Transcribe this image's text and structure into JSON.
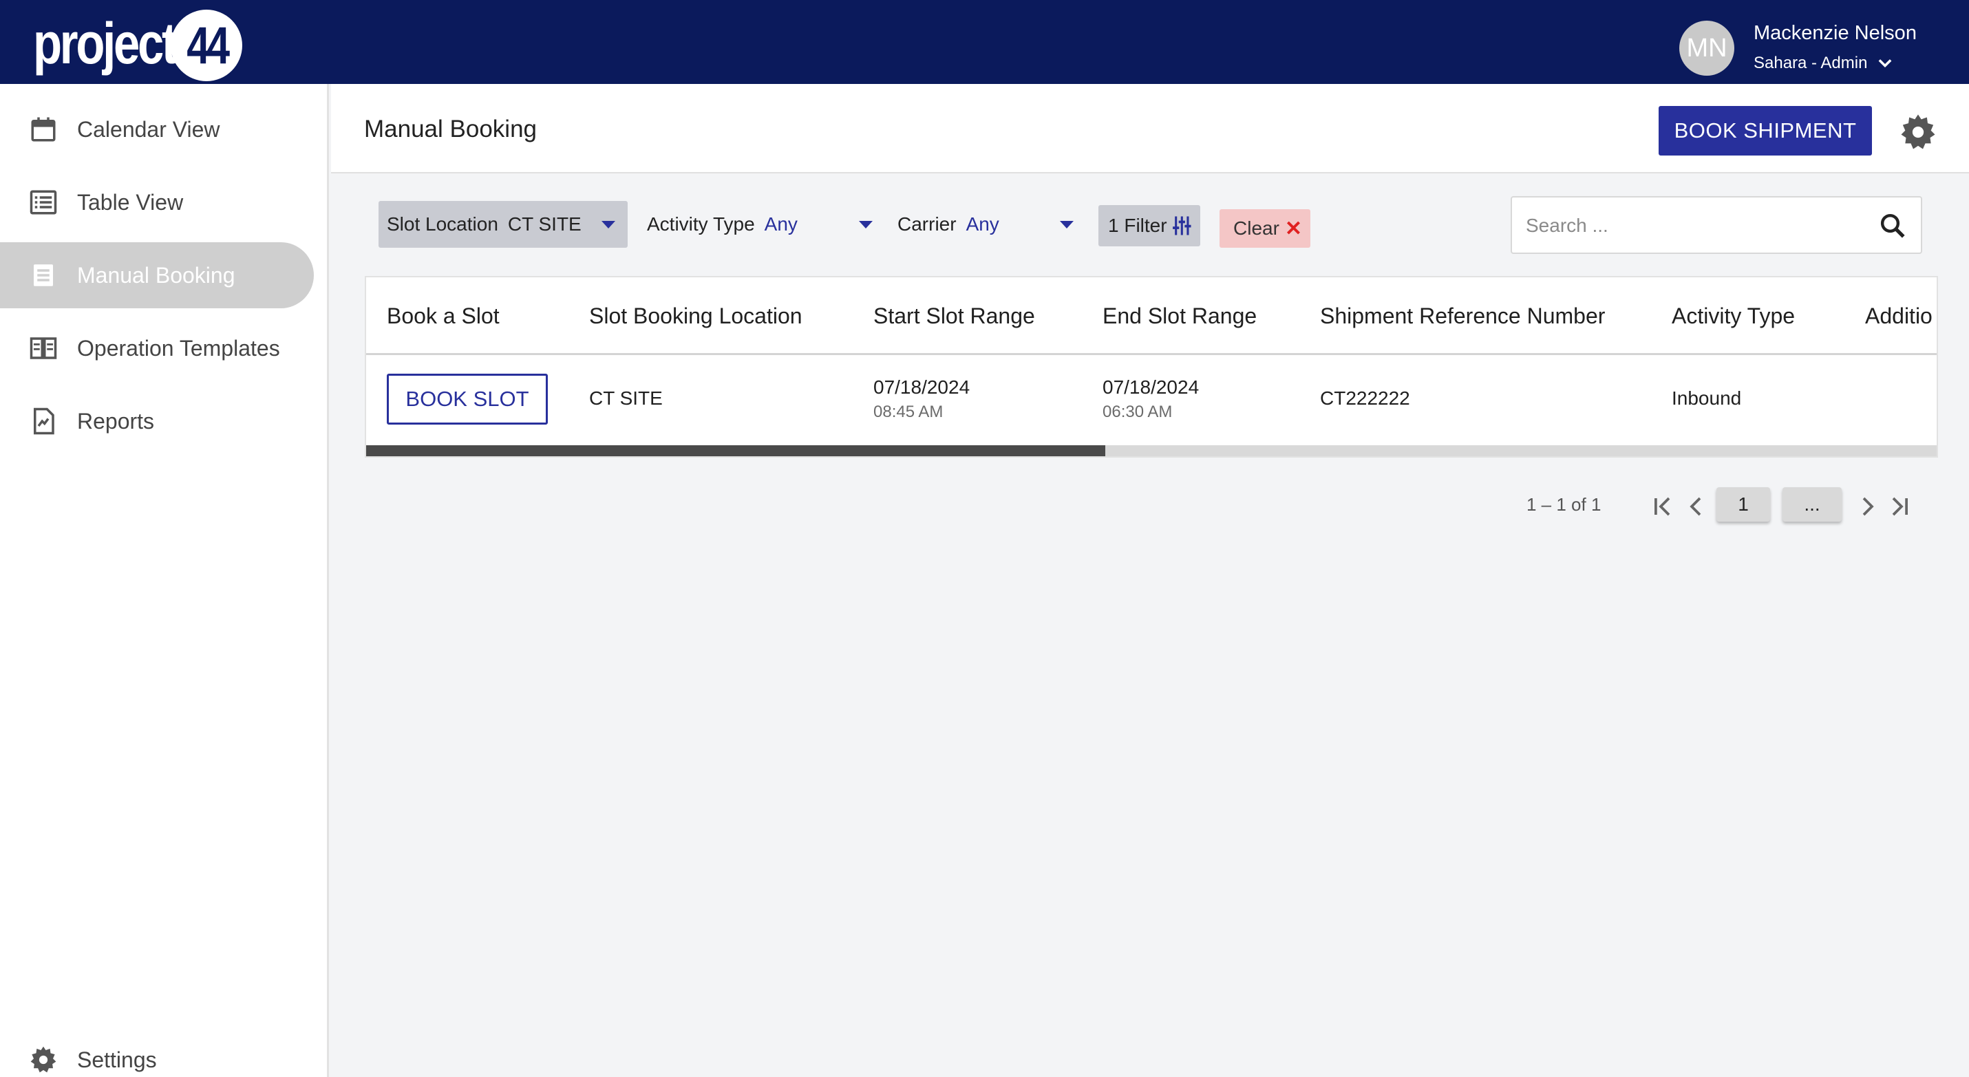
{
  "brand": {
    "logo_text": "project",
    "logo_number": "44"
  },
  "user": {
    "initials": "MN",
    "name": "Mackenzie Nelson",
    "role": "Sahara - Admin"
  },
  "sidebar": {
    "items": [
      {
        "label": "Calendar View",
        "icon": "calendar-icon"
      },
      {
        "label": "Table View",
        "icon": "list-icon"
      },
      {
        "label": "Manual Booking",
        "icon": "document-icon",
        "active": true
      },
      {
        "label": "Operation Templates",
        "icon": "book-icon"
      },
      {
        "label": "Reports",
        "icon": "report-icon"
      }
    ],
    "settings_label": "Settings"
  },
  "header": {
    "title": "Manual Booking",
    "book_shipment_label": "BOOK SHIPMENT"
  },
  "filters": {
    "slot_location": {
      "label": "Slot Location",
      "value": "CT SITE"
    },
    "activity_type": {
      "label": "Activity Type",
      "value": "Any"
    },
    "carrier": {
      "label": "Carrier",
      "value": "Any"
    },
    "filter_count_label": "1 Filter",
    "clear_label": "Clear",
    "search_placeholder": "Search ..."
  },
  "table": {
    "columns": [
      "Book a Slot",
      "Slot Booking Location",
      "Start Slot Range",
      "End Slot Range",
      "Shipment Reference Number",
      "Activity Type",
      "Additio"
    ],
    "rows": [
      {
        "action_label": "BOOK SLOT",
        "location": "CT SITE",
        "start_date": "07/18/2024",
        "start_time": "08:45 AM",
        "end_date": "07/18/2024",
        "end_time": "06:30 AM",
        "reference": "CT222222",
        "activity_type": "Inbound"
      }
    ],
    "horizontal_scroll_fraction": 0.47
  },
  "pagination": {
    "range_label": "1 – 1 of 1",
    "current_page": "1",
    "more_label": "..."
  },
  "colors": {
    "topbar": "#0b1a5c",
    "primary": "#28309c",
    "clear_bg": "#f4c6c6",
    "clear_x": "#e02020"
  }
}
